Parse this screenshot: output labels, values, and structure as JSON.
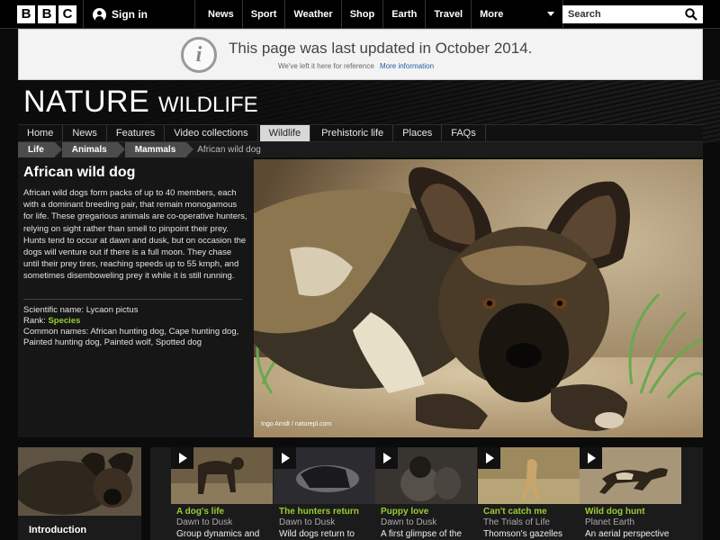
{
  "topbar": {
    "logo_letters": [
      "B",
      "B",
      "C"
    ],
    "signin_label": "Sign in",
    "nav": [
      "News",
      "Sport",
      "Weather",
      "Shop",
      "Earth",
      "Travel"
    ],
    "more_label": "More",
    "search_placeholder": "Search"
  },
  "notice": {
    "title": "This page was last updated in October 2014.",
    "subtitle": "We've left it here for reference",
    "link": "More information"
  },
  "header": {
    "title": "NATURE",
    "subtitle": "WILDLIFE"
  },
  "section_nav": [
    {
      "label": "Home"
    },
    {
      "label": "News"
    },
    {
      "label": "Features"
    },
    {
      "label": "Video collections"
    },
    {
      "label": "Wildlife",
      "active": true
    },
    {
      "label": "Prehistoric life"
    },
    {
      "label": "Places"
    },
    {
      "label": "FAQs"
    }
  ],
  "breadcrumb": {
    "items": [
      "Life",
      "Animals",
      "Mammals"
    ],
    "current": "African wild dog"
  },
  "article": {
    "title": "African wild dog",
    "description": "African wild dogs form packs of up to 40 members, each with a dominant breeding pair, that remain monogamous for life. These gregarious animals are co-operative hunters, relying on sight rather than smell to pinpoint their prey. Hunts tend to occur at dawn and dusk, but on occasion the dogs will venture out if there is a full moon. They chase until their prey tires, reaching speeds up to 55 kmph, and sometimes disemboweling prey it while it is still running.",
    "scientific_label": "Scientific name:",
    "scientific_name": "Lycaon pictus",
    "rank_label": "Rank:",
    "rank": "Species",
    "common_label": "Common names:",
    "common_names": "African hunting dog, Cape hunting dog, Painted hunting dog, Painted wolf, Spotted dog"
  },
  "hero": {
    "credit": "Ingo Arndt / naturepl.com"
  },
  "intro": {
    "label": "Introduction"
  },
  "clips": [
    {
      "title": "A dog's life",
      "series": "Dawn to Dusk",
      "desc": "Group dynamics and"
    },
    {
      "title": "The hunters return",
      "series": "Dawn to Dusk",
      "desc": "Wild dogs return to"
    },
    {
      "title": "Puppy love",
      "series": "Dawn to Dusk",
      "desc": "A first glimpse of the"
    },
    {
      "title": "Can't catch me",
      "series": "The Trials of Life",
      "desc": "Thomson's gazelles"
    },
    {
      "title": "Wild dog hunt",
      "series": "Planet Earth",
      "desc": "An aerial perspective"
    }
  ],
  "colors": {
    "accent_green": "#9acd32",
    "link_blue": "#1f5fa5",
    "background": "#0b0b0b"
  }
}
